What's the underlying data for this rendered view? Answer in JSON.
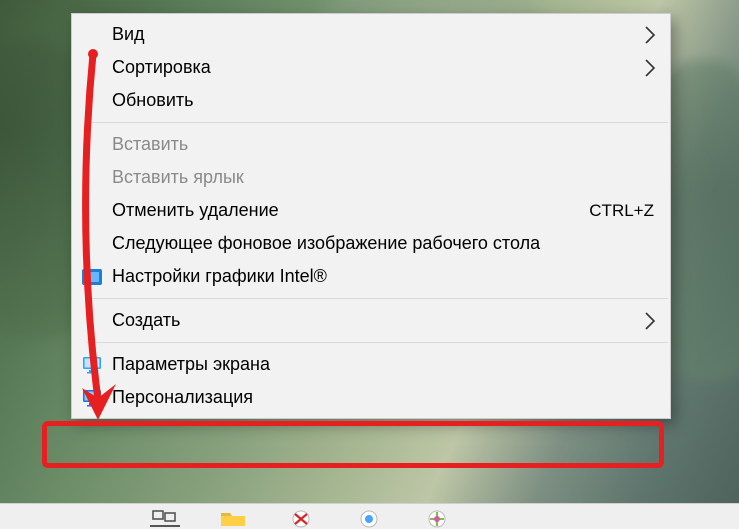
{
  "menu": {
    "items": [
      {
        "key": "view",
        "label": "Вид",
        "submenu": true
      },
      {
        "key": "sort",
        "label": "Сортировка",
        "submenu": true
      },
      {
        "key": "refresh",
        "label": "Обновить"
      },
      {
        "sep": true
      },
      {
        "key": "paste",
        "label": "Вставить",
        "disabled": true
      },
      {
        "key": "paste-shortcut",
        "label": "Вставить ярлык",
        "disabled": true
      },
      {
        "key": "undo-delete",
        "label": "Отменить удаление",
        "shortcut": "CTRL+Z"
      },
      {
        "key": "next-wallpaper",
        "label": "Следующее фоновое изображение рабочего стола"
      },
      {
        "key": "intel-gfx",
        "label": "Настройки графики Intel®",
        "icon": "intel"
      },
      {
        "sep": true
      },
      {
        "key": "new",
        "label": "Создать",
        "submenu": true
      },
      {
        "sep": true
      },
      {
        "key": "display",
        "label": "Параметры экрана",
        "icon": "monitor-blue"
      },
      {
        "key": "personalize",
        "label": "Персонализация",
        "icon": "monitor-paint"
      }
    ]
  },
  "annotations": {
    "highlight_target": "personalize"
  }
}
